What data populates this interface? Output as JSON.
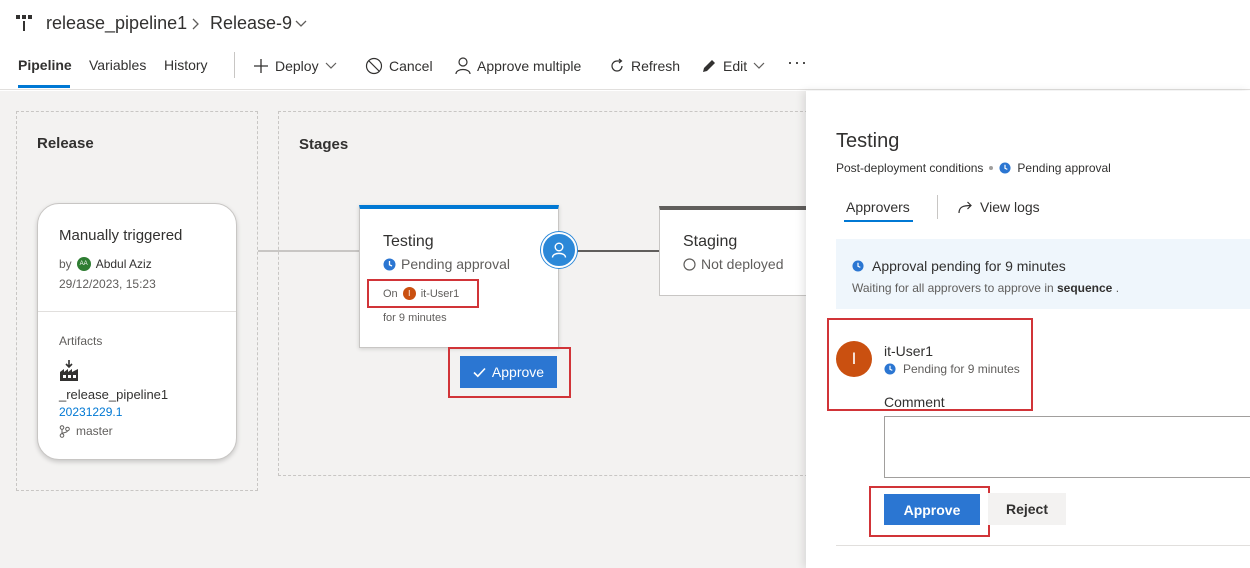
{
  "breadcrumb": {
    "pipeline_name": "release_pipeline1",
    "separator": "›",
    "release_name": "Release-9"
  },
  "tabs": [
    {
      "label": "Pipeline",
      "active": true
    },
    {
      "label": "Variables",
      "active": false
    },
    {
      "label": "History",
      "active": false
    }
  ],
  "toolbar": {
    "deploy": "Deploy",
    "cancel": "Cancel",
    "approve_multiple": "Approve multiple",
    "refresh": "Refresh",
    "edit": "Edit",
    "more": "···"
  },
  "release_section": {
    "title": "Release",
    "trigger_title": "Manually triggered",
    "by_label": "by",
    "user_initials": "AA",
    "user_name": "Abdul Aziz",
    "datetime": "29/12/2023, 15:23",
    "artifacts_label": "Artifacts",
    "artifact_name": "_release_pipeline1",
    "artifact_version": "20231229.1",
    "artifact_branch": "master"
  },
  "stages_section": {
    "title": "Stages",
    "testing": {
      "name": "Testing",
      "status": "Pending approval",
      "on_label": "On",
      "approver_initial": "I",
      "approver_name": "it-User1",
      "duration": "for 9 minutes",
      "approve_button": "Approve"
    },
    "staging": {
      "name": "Staging",
      "status": "Not deployed"
    }
  },
  "panel": {
    "title": "Testing",
    "subtitle_condition": "Post-deployment conditions",
    "subtitle_status": "Pending approval",
    "tab_approvers": "Approvers",
    "tab_logs": "View logs",
    "info_title": "Approval pending for 9 minutes",
    "info_desc_prefix": "Waiting for all approvers to approve in",
    "info_desc_bold": "sequence",
    "info_desc_suffix": ".",
    "approver_initial": "I",
    "approver_name": "it-User1",
    "approver_status": "Pending for 9 minutes",
    "comment_label": "Comment",
    "comment_value": "",
    "approve_button": "Approve",
    "reject_button": "Reject"
  },
  "colors": {
    "accent": "#0078d4",
    "button_blue": "#2b76d2",
    "highlight_red": "#d13438",
    "avatar_orange": "#ca5010",
    "avatar_green": "#2e7d32"
  }
}
